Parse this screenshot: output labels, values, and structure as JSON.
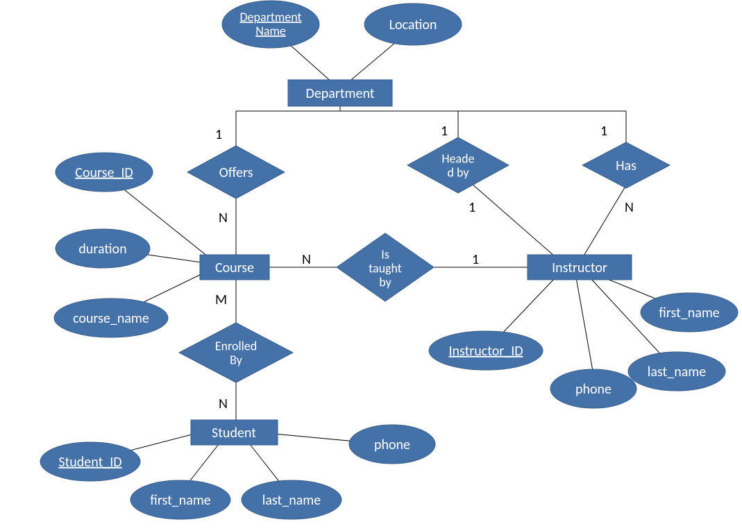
{
  "entities": {
    "department": "Department",
    "course": "Course",
    "instructor": "Instructor",
    "student": "Student"
  },
  "relationships": {
    "offers": "Offers",
    "headed_by_l1": "Heade",
    "headed_by_l2": "d by",
    "has": "Has",
    "is_taught_l1": "Is",
    "is_taught_l2": "taught",
    "is_taught_l3": "by",
    "enrolled_l1": "Enrolled",
    "enrolled_l2": "By"
  },
  "attributes": {
    "department_name_l1": "Department",
    "department_name_l2": "Name",
    "location": "Location",
    "course_id": "Course_ID",
    "duration": "duration",
    "course_name": "course_name",
    "instructor_id": "Instructor_ID",
    "instr_first_name": "first_name",
    "instr_last_name": "last_name",
    "instr_phone": "phone",
    "student_id": "Student_ID",
    "stud_first_name": "first_name",
    "stud_last_name": "last_name",
    "stud_phone": "phone"
  },
  "cardinalities": {
    "offers_top": "1",
    "offers_bottom": "N",
    "headed_top": "1",
    "headed_bottom": "1",
    "has_top": "1",
    "has_bottom": "N",
    "taught_left": "N",
    "taught_right": "1",
    "enrolled_top": "M",
    "enrolled_bottom": "N"
  }
}
